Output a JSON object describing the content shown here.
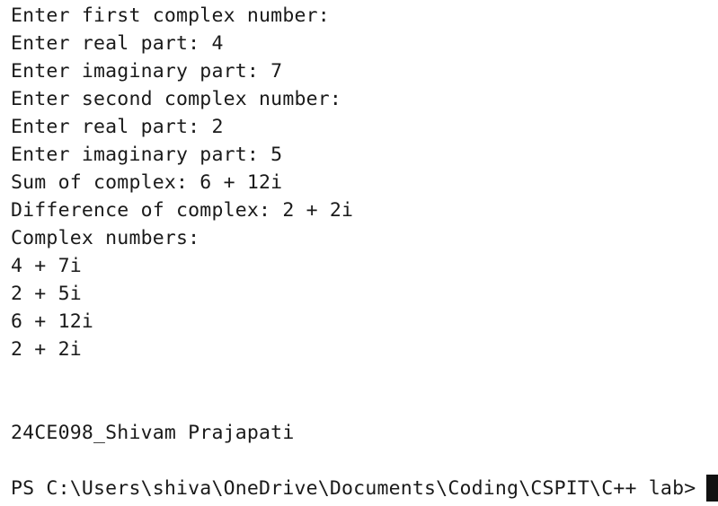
{
  "terminal": {
    "output_lines": [
      "Enter first complex number:",
      "Enter real part: 4",
      "Enter imaginary part: 7",
      "Enter second complex number:",
      "Enter real part: 2",
      "Enter imaginary part: 5",
      "Sum of complex: 6 + 12i",
      "Difference of complex: 2 + 2i",
      "Complex numbers:",
      "4 + 7i",
      "2 + 5i",
      "6 + 12i",
      "2 + 2i"
    ],
    "signature": "24CE098_Shivam Prajapati",
    "prompt": "PS C:\\Users\\shiva\\OneDrive\\Documents\\Coding\\CSPIT\\C++ lab>"
  }
}
